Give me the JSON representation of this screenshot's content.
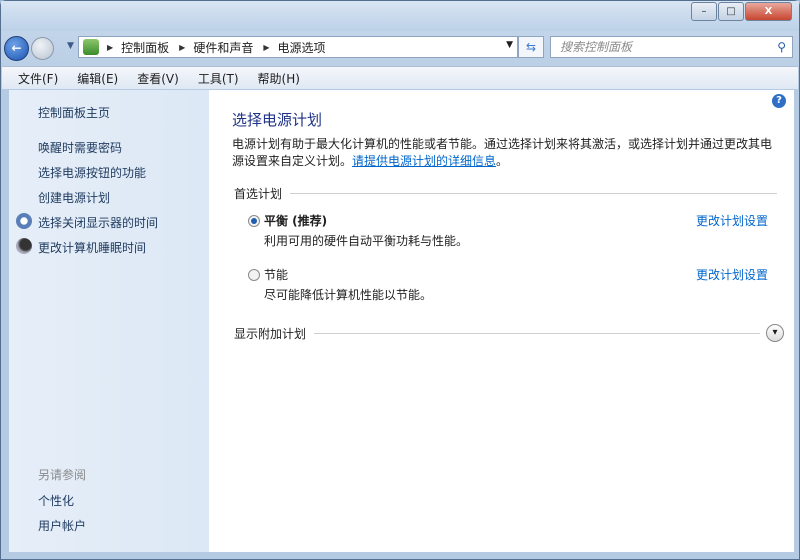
{
  "window": {
    "minimize": "–",
    "maximize": "□",
    "close": "X"
  },
  "address": {
    "crumbs": [
      "控制面板",
      "硬件和声音",
      "电源选项"
    ],
    "search_placeholder": "搜索控制面板"
  },
  "menu": [
    "文件(F)",
    "编辑(E)",
    "查看(V)",
    "工具(T)",
    "帮助(H)"
  ],
  "sidebar": {
    "home": "控制面板主页",
    "links": [
      "唤醒时需要密码",
      "选择电源按钮的功能",
      "创建电源计划",
      "选择关闭显示器的时间",
      "更改计算机睡眠时间"
    ],
    "see_also": "另请参阅",
    "see_also_links": [
      "个性化",
      "用户帐户"
    ]
  },
  "main": {
    "title": "选择电源计划",
    "desc": "电源计划有助于最大化计算机的性能或者节能。通过选择计划来将其激活，或选择计划并通过更改其电源设置来自定义计划。",
    "desc_link": "请提供电源计划的详细信息",
    "desc_end": "。",
    "preferred": "首选计划",
    "plans": [
      {
        "name": "平衡 (推荐)",
        "desc": "利用可用的硬件自动平衡功耗与性能。",
        "change": "更改计划设置",
        "selected": true
      },
      {
        "name": "节能",
        "desc": "尽可能降低计算机性能以节能。",
        "change": "更改计划设置",
        "selected": false
      }
    ],
    "more": "显示附加计划"
  }
}
